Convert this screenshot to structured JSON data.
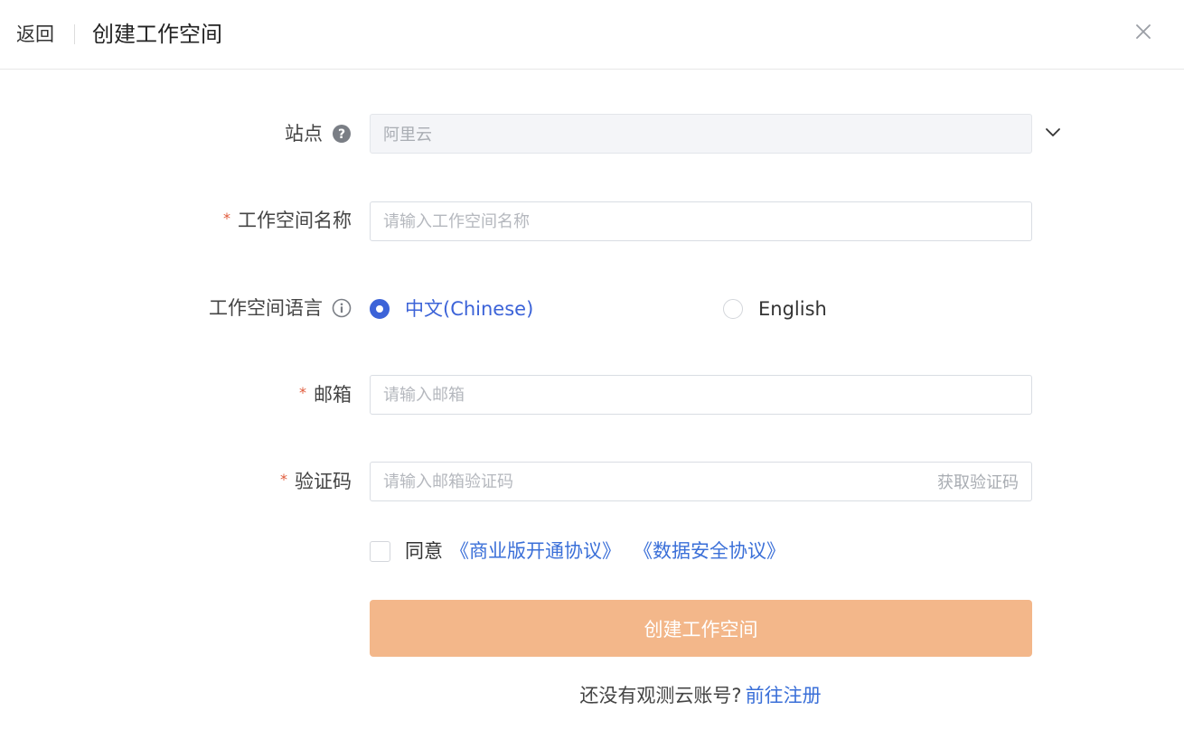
{
  "header": {
    "back_label": "返回",
    "title": "创建工作空间"
  },
  "form": {
    "site": {
      "label": "站点",
      "value": "阿里云"
    },
    "workspace_name": {
      "label": "工作空间名称",
      "placeholder": "请输入工作空间名称",
      "required_mark": "*"
    },
    "language": {
      "label": "工作空间语言",
      "options": [
        {
          "label": "中文(Chinese)",
          "checked": true
        },
        {
          "label": "English",
          "checked": false
        }
      ]
    },
    "email": {
      "label": "邮箱",
      "placeholder": "请输入邮箱",
      "required_mark": "*"
    },
    "code": {
      "label": "验证码",
      "placeholder": "请输入邮箱验证码",
      "get_code_label": "获取验证码",
      "required_mark": "*"
    },
    "agreement": {
      "prefix": "同意",
      "link1": "《商业版开通协议》",
      "link2": "《数据安全协议》"
    },
    "submit_label": "创建工作空间"
  },
  "footer": {
    "text": "还没有观测云账号?",
    "link": "前往注册"
  },
  "colors": {
    "accent_blue": "#3c63d8",
    "link_blue": "#3a6fd8",
    "submit_orange": "#f3b78a",
    "required_red": "#e05a3a"
  }
}
